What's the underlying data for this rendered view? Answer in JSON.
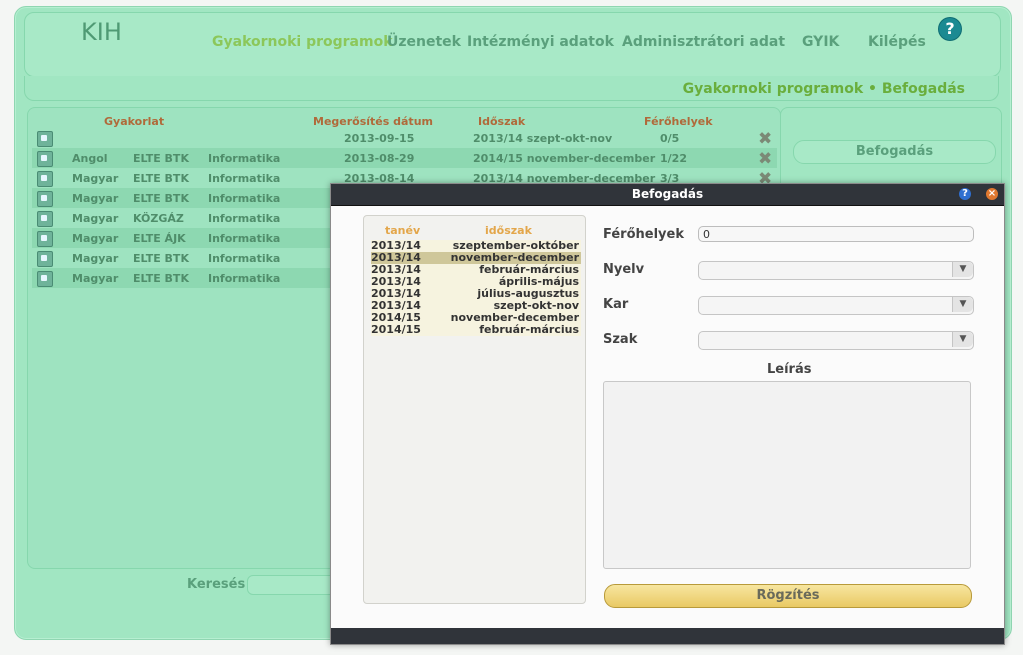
{
  "app": {
    "logo": "KIH"
  },
  "nav": [
    {
      "label": "Gyakornoki programok",
      "active": true
    },
    {
      "label": "Üzenetek"
    },
    {
      "label": "Intézményi adatok"
    },
    {
      "label": "Adminisztrátori adat"
    },
    {
      "label": "GYIK"
    },
    {
      "label": "Kilépés"
    }
  ],
  "help_glyph": "?",
  "breadcrumb": "Gyakornoki programok • Befogadás",
  "table": {
    "headers": [
      "Gyakorlat",
      "Megerősítés dátum",
      "Időszak",
      "Férőhelyek"
    ],
    "rows": [
      {
        "lang": "",
        "inst": "",
        "field": "",
        "date": "2013-09-15",
        "period": "2013/14 szept-okt-nov",
        "places": "0/5"
      },
      {
        "lang": "Angol",
        "inst": "ELTE BTK",
        "field": "Informatika",
        "date": "2013-08-29",
        "period": "2014/15 november-december",
        "places": "1/22"
      },
      {
        "lang": "Magyar",
        "inst": "ELTE BTK",
        "field": "Informatika",
        "date": "2013-08-14",
        "period": "2013/14 november-december",
        "places": "3/3"
      },
      {
        "lang": "Magyar",
        "inst": "ELTE BTK",
        "field": "Informatika",
        "date": "",
        "period": "",
        "places": ""
      },
      {
        "lang": "Magyar",
        "inst": "KÖZGÁZ",
        "field": "Informatika",
        "date": "",
        "period": "",
        "places": ""
      },
      {
        "lang": "Magyar",
        "inst": "ELTE ÁJK",
        "field": "Informatika",
        "date": "",
        "period": "",
        "places": ""
      },
      {
        "lang": "Magyar",
        "inst": "ELTE BTK",
        "field": "Informatika",
        "date": "",
        "period": "",
        "places": ""
      },
      {
        "lang": "Magyar",
        "inst": "ELTE BTK",
        "field": "Informatika",
        "date": "",
        "period": "",
        "places": ""
      }
    ]
  },
  "search": {
    "label": "Keresés"
  },
  "side": {
    "button": "Befogadás"
  },
  "dialog": {
    "title": "Befogadás",
    "help": "?",
    "close": "×",
    "terms_headers": {
      "year": "tanév",
      "period": "időszak"
    },
    "terms": [
      {
        "year": "2013/14",
        "period": "szeptember-október"
      },
      {
        "year": "2013/14",
        "period": "november-december",
        "selected": true
      },
      {
        "year": "2013/14",
        "period": "február-március"
      },
      {
        "year": "2013/14",
        "period": "április-május"
      },
      {
        "year": "2013/14",
        "period": "július-augusztus"
      },
      {
        "year": "2013/14",
        "period": "szept-okt-nov"
      },
      {
        "year": "2014/15",
        "period": "november-december"
      },
      {
        "year": "2014/15",
        "period": "február-március"
      }
    ],
    "fields": {
      "ferohelyek_label": "Férőhelyek",
      "ferohelyek_value": "0",
      "nyelv_label": "Nyelv",
      "kar_label": "Kar",
      "szak_label": "Szak",
      "leiras_label": "Leírás"
    },
    "save": "Rögzítés"
  }
}
